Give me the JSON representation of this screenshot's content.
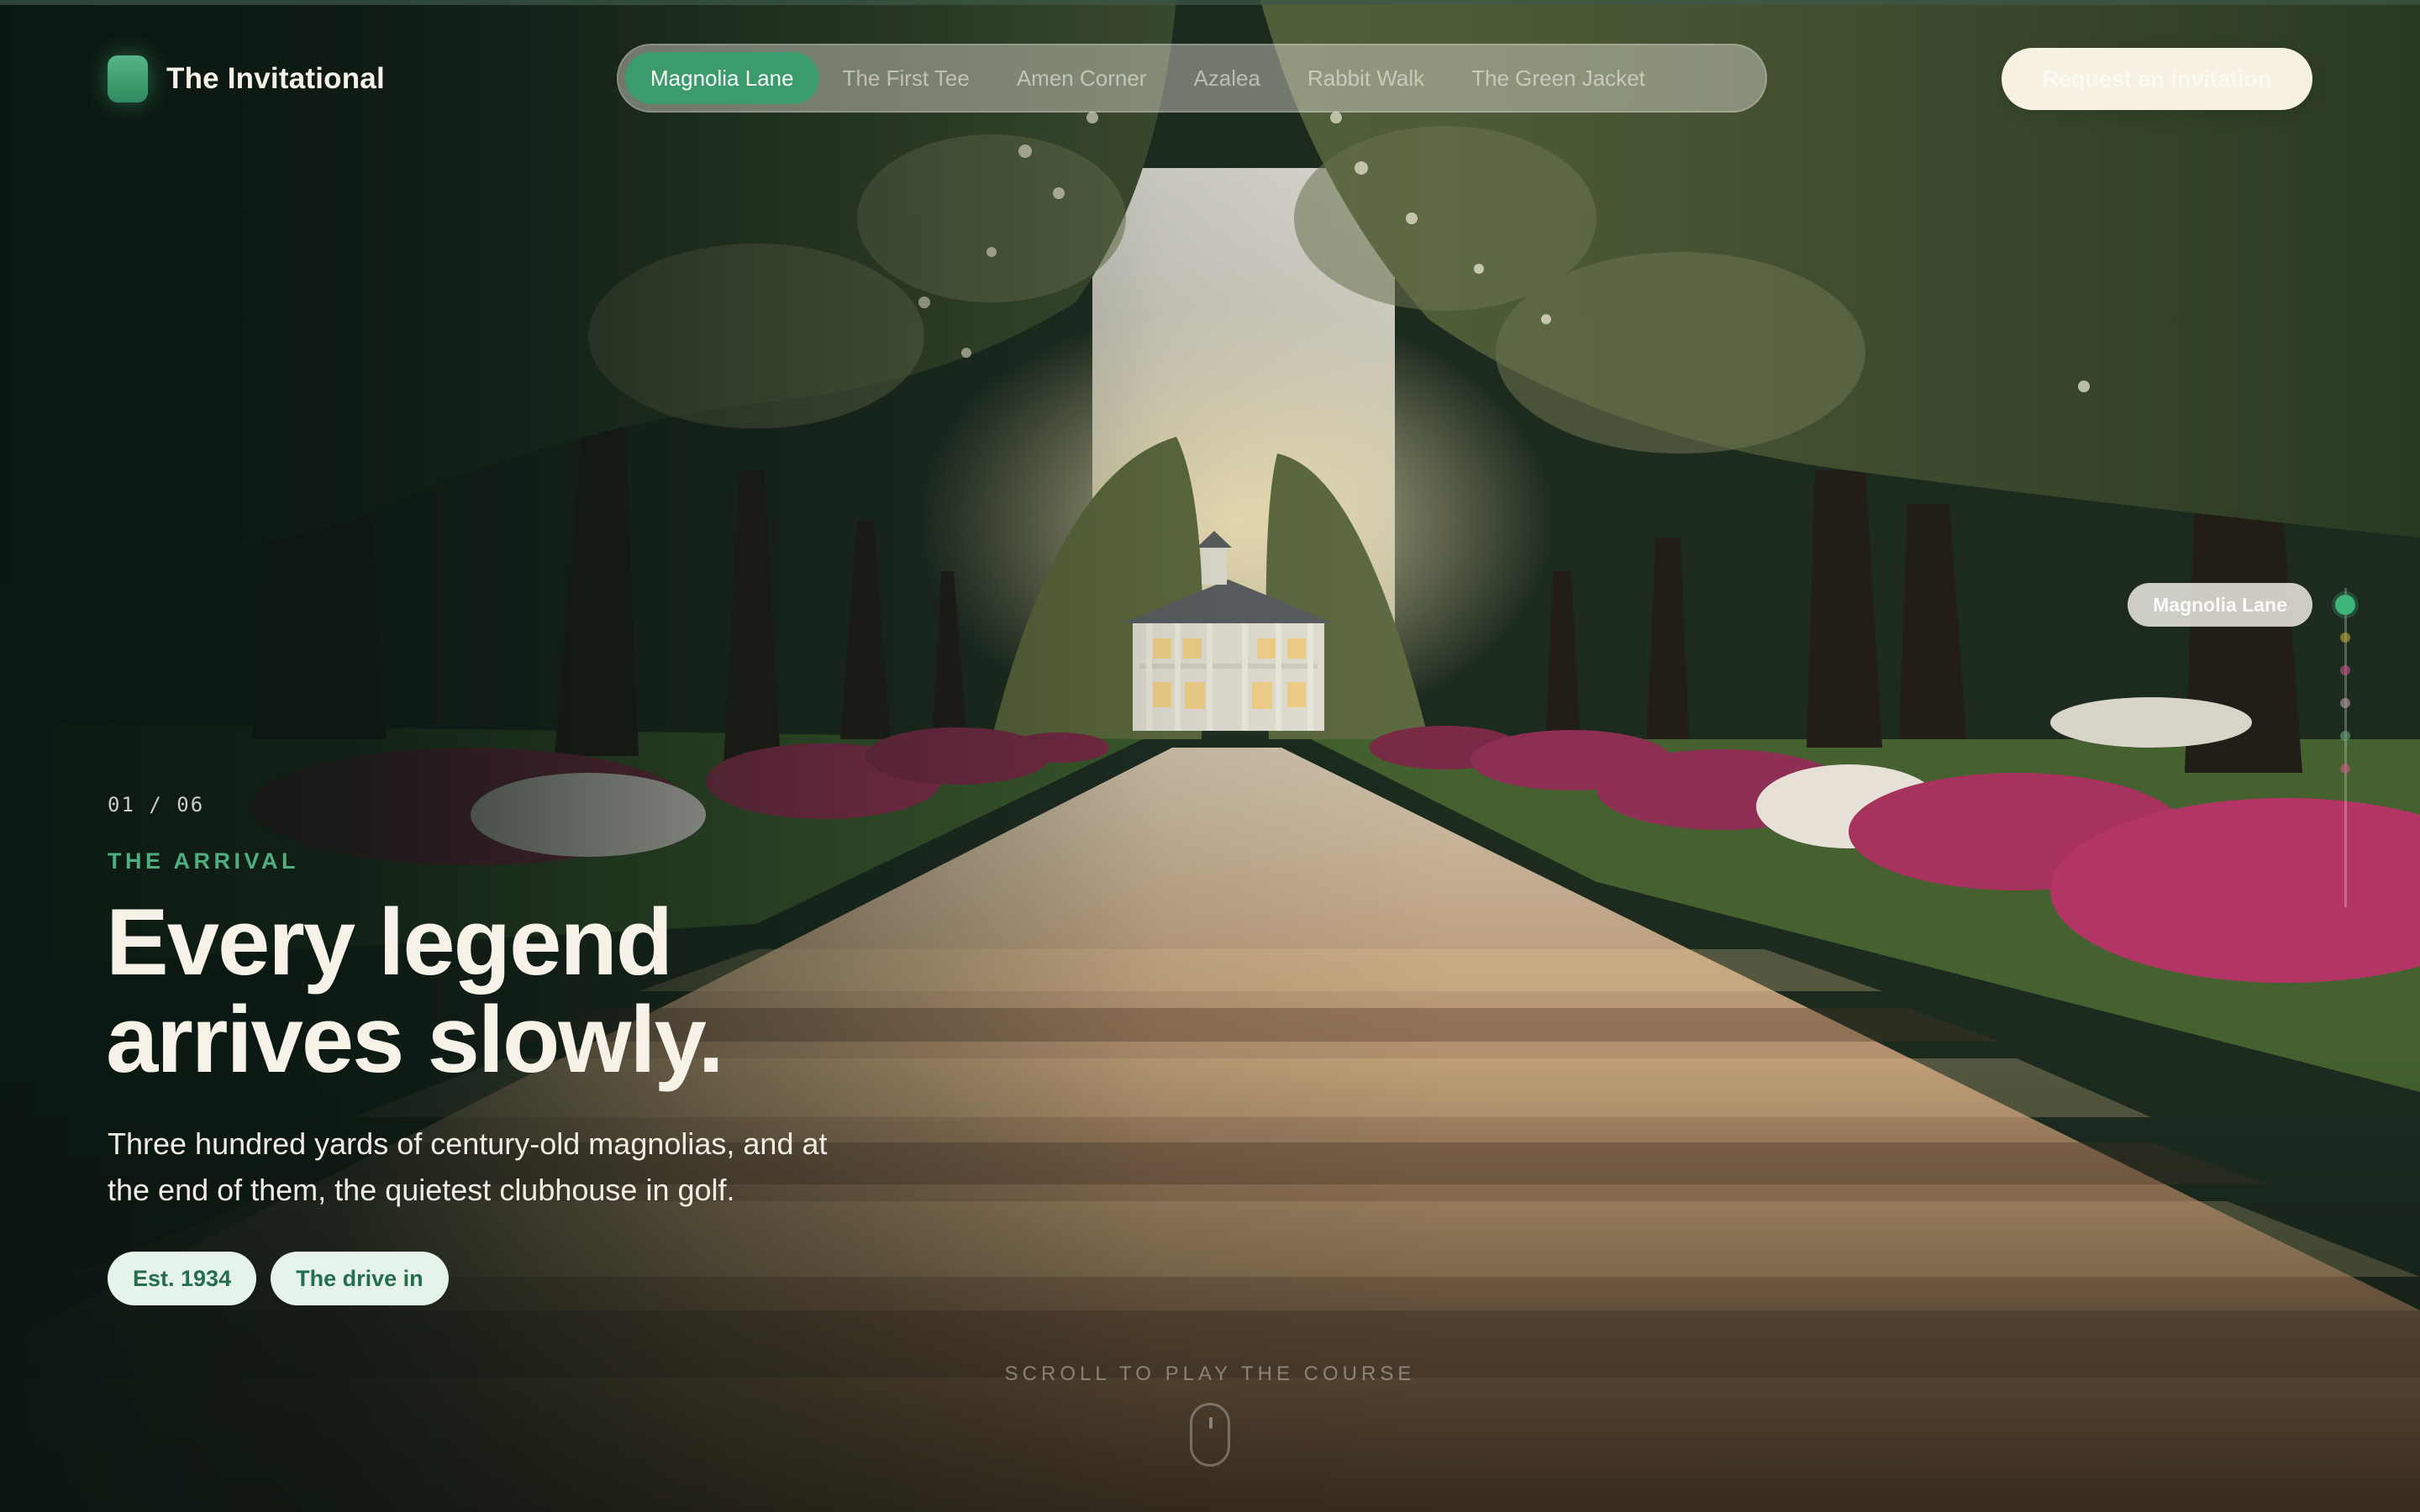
{
  "brand": {
    "name": "The Invitational"
  },
  "nav": {
    "items": [
      {
        "label": "Magnolia Lane",
        "active": true
      },
      {
        "label": "The First Tee",
        "active": false
      },
      {
        "label": "Amen Corner",
        "active": false
      },
      {
        "label": "Azalea",
        "active": false
      },
      {
        "label": "Rabbit Walk",
        "active": false
      },
      {
        "label": "The Green Jacket",
        "active": false
      }
    ]
  },
  "cta": {
    "label": "Request an invitation"
  },
  "rail": {
    "current_label": "Magnolia Lane",
    "current_index": 1,
    "total": 6,
    "dot_colors": [
      "#3fb57c",
      "#c9b23a",
      "#d2578a",
      "#c9a5b3",
      "#6ab07c",
      "#d2578a"
    ]
  },
  "hero": {
    "counter": "01 / 06",
    "eyebrow": "THE ARRIVAL",
    "headline_line1": "Every legend",
    "headline_line2": "arrives slowly.",
    "subtext": "Three hundred yards of century-old magnolias, and at the end of them, the quietest clubhouse in golf.",
    "tags": [
      "Est. 1934",
      "The drive in"
    ]
  },
  "scroll_hint": {
    "label": "SCROLL TO PLAY THE COURSE"
  },
  "colors": {
    "accent": "#3c9b6c",
    "accent_text": "#4fae80",
    "cream": "#f6f1e3",
    "dark_green": "#0d1712"
  }
}
